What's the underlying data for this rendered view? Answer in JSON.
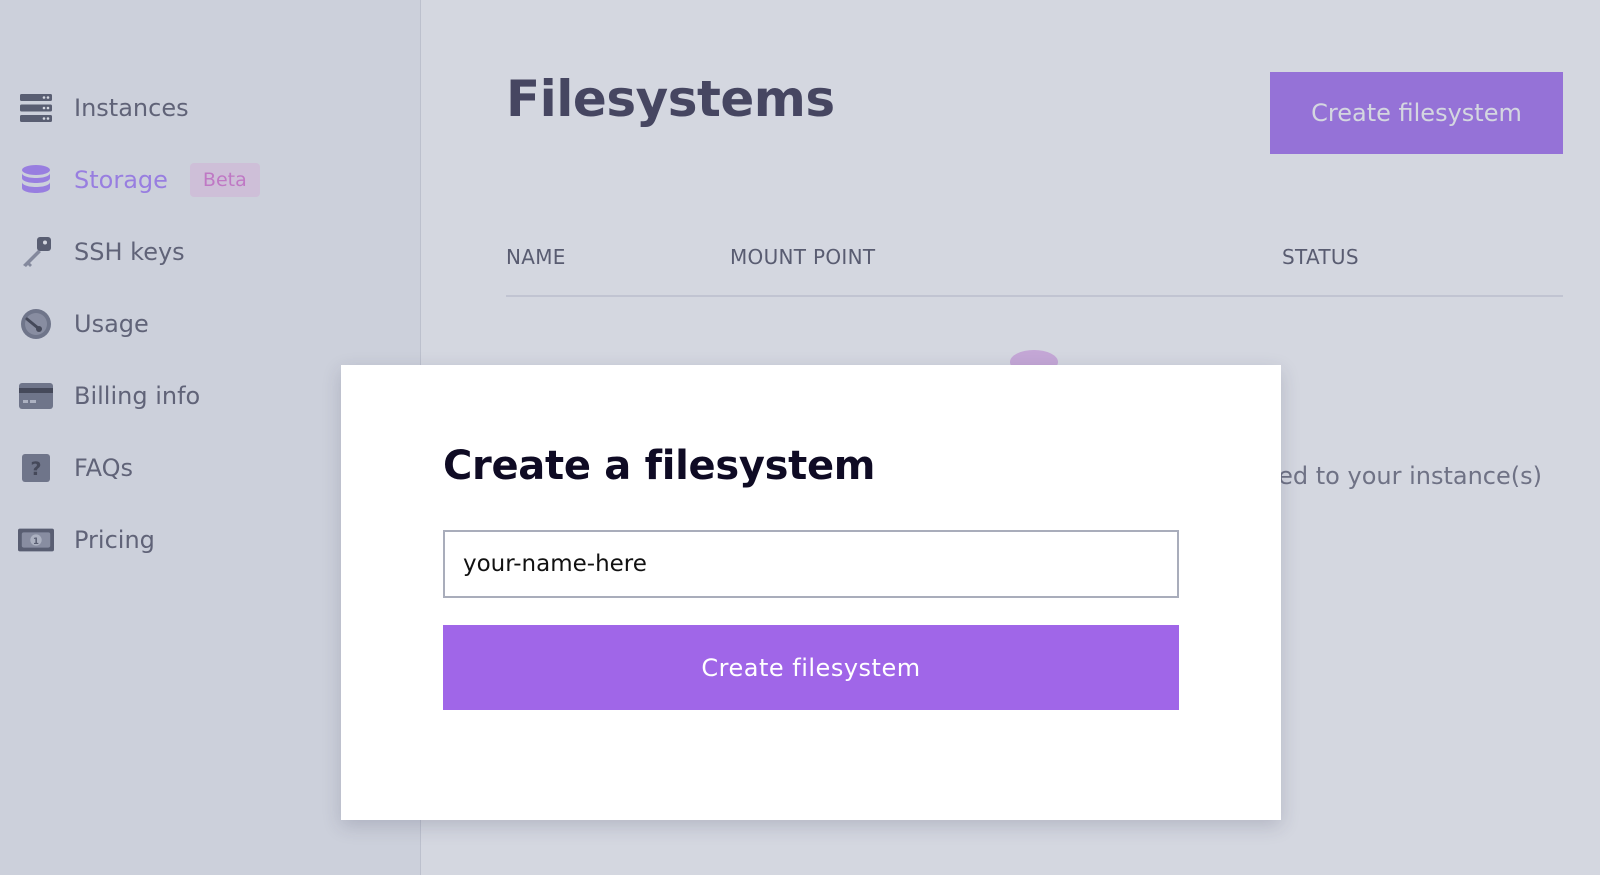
{
  "sidebar": {
    "items": [
      {
        "label": "Instances",
        "icon": "server-icon"
      },
      {
        "label": "Storage",
        "icon": "database-icon",
        "badge": "Beta",
        "active": true
      },
      {
        "label": "SSH keys",
        "icon": "key-icon"
      },
      {
        "label": "Usage",
        "icon": "gauge-icon"
      },
      {
        "label": "Billing info",
        "icon": "credit-card-icon"
      },
      {
        "label": "FAQs",
        "icon": "question-icon"
      },
      {
        "label": "Pricing",
        "icon": "banknote-icon"
      }
    ]
  },
  "main": {
    "title": "Filesystems",
    "create_button": "Create filesystem",
    "table": {
      "columns": [
        "NAME",
        "MOUNT POINT",
        "STATUS"
      ]
    },
    "empty_text_partial": "ed to your instance(s)"
  },
  "modal": {
    "title": "Create a filesystem",
    "input": {
      "value": "your-name-here",
      "placeholder": ""
    },
    "submit_button": "Create filesystem"
  },
  "colors": {
    "accent": "#a066e8",
    "badge_bg": "#f7dcf4",
    "badge_text": "#e174d6",
    "active_nav": "#a77cff"
  }
}
